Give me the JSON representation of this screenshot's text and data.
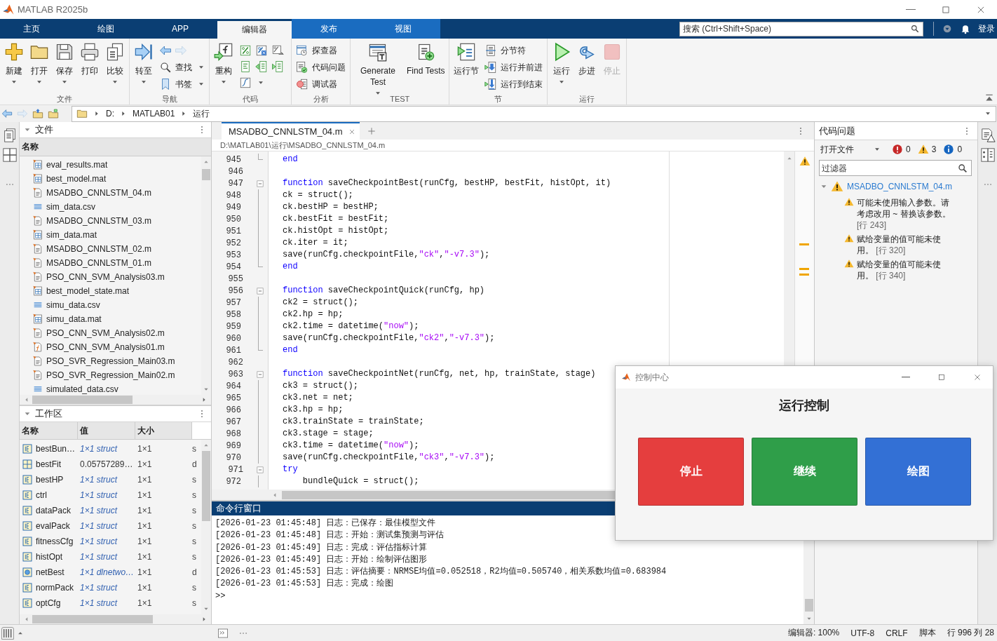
{
  "window": {
    "title": "MATLAB R2025b"
  },
  "tabs": [
    {
      "label": "主页",
      "selected": false,
      "contextual": false
    },
    {
      "label": "绘图",
      "selected": false,
      "contextual": false
    },
    {
      "label": "APP",
      "selected": false,
      "contextual": false
    },
    {
      "label": "编辑器",
      "selected": true,
      "contextual": true
    },
    {
      "label": "发布",
      "selected": false,
      "contextual": true
    },
    {
      "label": "视图",
      "selected": false,
      "contextual": true
    }
  ],
  "search": {
    "placeholder": "搜索 (Ctrl+Shift+Space)"
  },
  "sign_in": "登录",
  "toolstrip": {
    "groups": [
      {
        "title": "文件",
        "items": [
          {
            "kind": "large",
            "label": "新建",
            "dropdown": true
          },
          {
            "kind": "large",
            "label": "打开",
            "dropdown": true
          },
          {
            "kind": "large",
            "label": "保存",
            "dropdown": true
          },
          {
            "kind": "large",
            "label": "打印",
            "dropdown": false
          },
          {
            "kind": "large",
            "label": "比较",
            "dropdown": true
          }
        ]
      },
      {
        "title": "导航",
        "items": [
          {
            "kind": "large",
            "label": "转至",
            "dropdown": true
          },
          {
            "kind": "nav",
            "back_disabled": false,
            "forward_disabled": true
          },
          {
            "kind": "small",
            "label": "查找",
            "dropdown": true
          },
          {
            "kind": "small",
            "label": "书签",
            "dropdown": true
          }
        ]
      },
      {
        "title": "代码",
        "items": [
          {
            "kind": "large",
            "label": "重构",
            "dropdown": true
          },
          {
            "kind": "icon",
            "dropdown": false
          },
          {
            "kind": "icon",
            "dropdown": false
          },
          {
            "kind": "icon",
            "dropdown": false
          },
          {
            "kind": "icon",
            "dropdown": false
          },
          {
            "kind": "icon",
            "dropdown": false
          },
          {
            "kind": "icon",
            "dropdown": false
          },
          {
            "kind": "icon",
            "dropdown": true
          }
        ]
      },
      {
        "title": "分析",
        "items": [
          {
            "kind": "small",
            "label": "探查器",
            "dropdown": false
          },
          {
            "kind": "small",
            "label": "代码问题",
            "dropdown": false
          },
          {
            "kind": "small",
            "label": "调试器",
            "dropdown": false
          }
        ]
      },
      {
        "title": "TEST",
        "items": [
          {
            "kind": "large",
            "label": "Generate Test",
            "dropdown": true
          },
          {
            "kind": "large",
            "label": "Find Tests",
            "dropdown": false
          }
        ]
      },
      {
        "title": "节",
        "items": [
          {
            "kind": "large",
            "label": "运行节",
            "dropdown": false
          },
          {
            "kind": "small",
            "label": "分节符",
            "dropdown": false
          },
          {
            "kind": "small",
            "label": "运行并前进",
            "dropdown": false
          },
          {
            "kind": "small",
            "label": "运行到结束",
            "dropdown": false
          }
        ]
      },
      {
        "title": "运行",
        "items": [
          {
            "kind": "large",
            "label": "运行",
            "dropdown": true,
            "disabled": false
          },
          {
            "kind": "large",
            "label": "步进",
            "dropdown": false,
            "disabled": false
          },
          {
            "kind": "large",
            "label": "停止",
            "dropdown": false,
            "disabled": true
          }
        ]
      }
    ]
  },
  "address": {
    "segments": [
      "D:",
      "MATLAB01",
      "运行"
    ]
  },
  "files": {
    "title": "文件",
    "column": "名称",
    "items": [
      {
        "name": "eval_results.mat",
        "kind": "mat"
      },
      {
        "name": "best_model.mat",
        "kind": "mat"
      },
      {
        "name": "MSADBO_CNNLSTM_04.m",
        "kind": "m"
      },
      {
        "name": "sim_data.csv",
        "kind": "csv"
      },
      {
        "name": "MSADBO_CNNLSTM_03.m",
        "kind": "m"
      },
      {
        "name": "sim_data.mat",
        "kind": "mat"
      },
      {
        "name": "MSADBO_CNNLSTM_02.m",
        "kind": "m"
      },
      {
        "name": "MSADBO_CNNLSTM_01.m",
        "kind": "m"
      },
      {
        "name": "PSO_CNN_SVM_Analysis03.m",
        "kind": "m"
      },
      {
        "name": "best_model_state.mat",
        "kind": "mat"
      },
      {
        "name": "simu_data.csv",
        "kind": "csv"
      },
      {
        "name": "simu_data.mat",
        "kind": "mat"
      },
      {
        "name": "PSO_CNN_SVM_Analysis02.m",
        "kind": "m"
      },
      {
        "name": "PSO_CNN_SVM_Analysis01.m",
        "kind": "func"
      },
      {
        "name": "PSO_SVR_Regression_Main03.m",
        "kind": "m"
      },
      {
        "name": "PSO_SVR_Regression_Main02.m",
        "kind": "m"
      },
      {
        "name": "simulated_data.csv",
        "kind": "csv"
      }
    ]
  },
  "workspace": {
    "title": "工作区",
    "columns": [
      "名称",
      "值",
      "大小"
    ],
    "rows": [
      {
        "name": "bestBun…",
        "value": "1×1 struct",
        "size": "1×1",
        "column_4": "s",
        "kind": "struct"
      },
      {
        "name": "bestFit",
        "value": "0.05757289…",
        "size": "1×1",
        "column_4": "d",
        "kind": "double"
      },
      {
        "name": "bestHP",
        "value": "1×1 struct",
        "size": "1×1",
        "column_4": "s",
        "kind": "struct"
      },
      {
        "name": "ctrl",
        "value": "1×1 struct",
        "size": "1×1",
        "column_4": "s",
        "kind": "struct"
      },
      {
        "name": "dataPack",
        "value": "1×1 struct",
        "size": "1×1",
        "column_4": "s",
        "kind": "struct"
      },
      {
        "name": "evalPack",
        "value": "1×1 struct",
        "size": "1×1",
        "column_4": "s",
        "kind": "struct"
      },
      {
        "name": "fitnessCfg",
        "value": "1×1 struct",
        "size": "1×1",
        "column_4": "s",
        "kind": "struct"
      },
      {
        "name": "histOpt",
        "value": "1×1 struct",
        "size": "1×1",
        "column_4": "s",
        "kind": "struct"
      },
      {
        "name": "netBest",
        "value": "1×1 dlnetwo…",
        "size": "1×1",
        "column_4": "d",
        "kind": "object"
      },
      {
        "name": "normPack",
        "value": "1×1 struct",
        "size": "1×1",
        "column_4": "s",
        "kind": "struct"
      },
      {
        "name": "optCfg",
        "value": "1×1 struct",
        "size": "1×1",
        "column_4": "s",
        "kind": "struct"
      }
    ]
  },
  "editor": {
    "tabs": [
      {
        "label": "MSADBO_CNNLSTM_04.m",
        "selected": true
      }
    ],
    "path": "D:\\MATLAB01\\运行\\MSADBO_CNNLSTM_04.m",
    "lines": [
      {
        "number": "945",
        "kind": "end",
        "tokens": [
          {
            "text": "end",
            "kind": "keyword"
          }
        ]
      },
      {
        "number": "946",
        "kind": "none"
      },
      {
        "number": "947",
        "kind": "start",
        "tokens": [
          {
            "text": "function",
            "kind": "keyword"
          },
          {
            "text": " saveCheckpointBest(runCfg, bestHP, bestFit, histOpt, it)",
            "kind": "plain"
          }
        ]
      },
      {
        "number": "948",
        "kind": "body",
        "tokens": [
          {
            "text": "ck = struct();",
            "kind": "plain"
          }
        ]
      },
      {
        "number": "949",
        "kind": "body",
        "tokens": [
          {
            "text": "ck.bestHP = bestHP;",
            "kind": "plain"
          }
        ]
      },
      {
        "number": "950",
        "kind": "body",
        "tokens": [
          {
            "text": "ck.bestFit = bestFit;",
            "kind": "plain"
          }
        ]
      },
      {
        "number": "951",
        "kind": "body",
        "tokens": [
          {
            "text": "ck.histOpt = histOpt;",
            "kind": "plain"
          }
        ]
      },
      {
        "number": "952",
        "kind": "body",
        "tokens": [
          {
            "text": "ck.iter = it;",
            "kind": "plain"
          }
        ]
      },
      {
        "number": "953",
        "kind": "body",
        "tokens": [
          {
            "text": "save(runCfg.checkpointFile,",
            "kind": "plain"
          },
          {
            "text": "\"ck\"",
            "kind": "string"
          },
          {
            "text": ",",
            "kind": "plain"
          },
          {
            "text": "\"-v7.3\"",
            "kind": "string"
          },
          {
            "text": ");",
            "kind": "plain"
          }
        ]
      },
      {
        "number": "954",
        "kind": "end",
        "tokens": [
          {
            "text": "end",
            "kind": "keyword"
          }
        ]
      },
      {
        "number": "955",
        "kind": "none"
      },
      {
        "number": "956",
        "kind": "start",
        "tokens": [
          {
            "text": "function",
            "kind": "keyword"
          },
          {
            "text": " saveCheckpointQuick(runCfg, hp)",
            "kind": "plain"
          }
        ]
      },
      {
        "number": "957",
        "kind": "body",
        "tokens": [
          {
            "text": "ck2 = struct();",
            "kind": "plain"
          }
        ]
      },
      {
        "number": "958",
        "kind": "body",
        "tokens": [
          {
            "text": "ck2.hp = hp;",
            "kind": "plain"
          }
        ]
      },
      {
        "number": "959",
        "kind": "body",
        "tokens": [
          {
            "text": "ck2.time = datetime(",
            "kind": "plain"
          },
          {
            "text": "\"now\"",
            "kind": "string"
          },
          {
            "text": ");",
            "kind": "plain"
          }
        ]
      },
      {
        "number": "960",
        "kind": "body",
        "tokens": [
          {
            "text": "save(runCfg.checkpointFile,",
            "kind": "plain"
          },
          {
            "text": "\"ck2\"",
            "kind": "string"
          },
          {
            "text": ",",
            "kind": "plain"
          },
          {
            "text": "\"-v7.3\"",
            "kind": "string"
          },
          {
            "text": ");",
            "kind": "plain"
          }
        ]
      },
      {
        "number": "961",
        "kind": "end",
        "tokens": [
          {
            "text": "end",
            "kind": "keyword"
          }
        ]
      },
      {
        "number": "962",
        "kind": "none"
      },
      {
        "number": "963",
        "kind": "start",
        "tokens": [
          {
            "text": "function",
            "kind": "keyword"
          },
          {
            "text": " saveCheckpointNet(runCfg, net, hp, trainState, stage)",
            "kind": "plain"
          }
        ]
      },
      {
        "number": "964",
        "kind": "body",
        "tokens": [
          {
            "text": "ck3 = struct();",
            "kind": "plain"
          }
        ]
      },
      {
        "number": "965",
        "kind": "body",
        "tokens": [
          {
            "text": "ck3.net = net;",
            "kind": "plain"
          }
        ]
      },
      {
        "number": "966",
        "kind": "body",
        "tokens": [
          {
            "text": "ck3.hp = hp;",
            "kind": "plain"
          }
        ]
      },
      {
        "number": "967",
        "kind": "body",
        "tokens": [
          {
            "text": "ck3.trainState = trainState;",
            "kind": "plain"
          }
        ]
      },
      {
        "number": "968",
        "kind": "body",
        "tokens": [
          {
            "text": "ck3.stage = stage;",
            "kind": "plain"
          }
        ]
      },
      {
        "number": "969",
        "kind": "body",
        "tokens": [
          {
            "text": "ck3.time = datetime(",
            "kind": "plain"
          },
          {
            "text": "\"now\"",
            "kind": "string"
          },
          {
            "text": ");",
            "kind": "plain"
          }
        ]
      },
      {
        "number": "970",
        "kind": "body",
        "tokens": [
          {
            "text": "save(runCfg.checkpointFile,",
            "kind": "plain"
          },
          {
            "text": "\"ck3\"",
            "kind": "string"
          },
          {
            "text": ",",
            "kind": "plain"
          },
          {
            "text": "\"-v7.3\"",
            "kind": "string"
          },
          {
            "text": ");",
            "kind": "plain"
          }
        ]
      },
      {
        "number": "971",
        "kind": "start",
        "tokens": [
          {
            "text": "try",
            "kind": "keyword"
          }
        ]
      },
      {
        "number": "972",
        "kind": "body",
        "tokens": [
          {
            "text": "    bundleQuick = struct();",
            "kind": "plain"
          }
        ]
      }
    ]
  },
  "command_window": {
    "title": "命令行窗口",
    "lines": [
      "[2026-01-23 01:45:48] 日志：已保存：最佳模型文件",
      "[2026-01-23 01:45:48] 日志：开始：测试集预测与评估",
      "[2026-01-23 01:45:49] 日志：完成：评估指标计算",
      "[2026-01-23 01:45:49] 日志：开始：绘制评估图形",
      "[2026-01-23 01:45:53] 日志：评估摘要：NRMSE均值=0.052518，R2均值=0.505740，相关系数均值=0.683984",
      "[2026-01-23 01:45:53] 日志：完成：绘图"
    ],
    "prompt": ">>"
  },
  "code_issues": {
    "title": "代码问题",
    "scope": "打开文件",
    "errors": "0",
    "warnings": "3",
    "infos": "0",
    "filter": {
      "placeholder": "过滤器"
    },
    "files": [
      {
        "name": "MSADBO_CNNLSTM_04.m",
        "expanded": true,
        "issues": [
          {
            "message": "可能未使用输入参数。请考虑改用 ~ 替换该参数。",
            "line_ref": "[行 243]"
          },
          {
            "message": "赋给变量的值可能未使用。",
            "line_ref": "[行 320]"
          },
          {
            "message": "赋给变量的值可能未使用。",
            "line_ref": "[行 340]"
          }
        ]
      }
    ]
  },
  "dialog": {
    "title": "控制中心",
    "heading": "运行控制",
    "buttons": [
      {
        "label": "停止",
        "color": "#e53e3e"
      },
      {
        "label": "继续",
        "color": "#2f9e49"
      },
      {
        "label": "绘图",
        "color": "#3370d5"
      }
    ]
  },
  "status_bar": [
    "编辑器: 100%",
    "UTF-8",
    "CRLF",
    "脚本",
    "行 996 列 28"
  ]
}
